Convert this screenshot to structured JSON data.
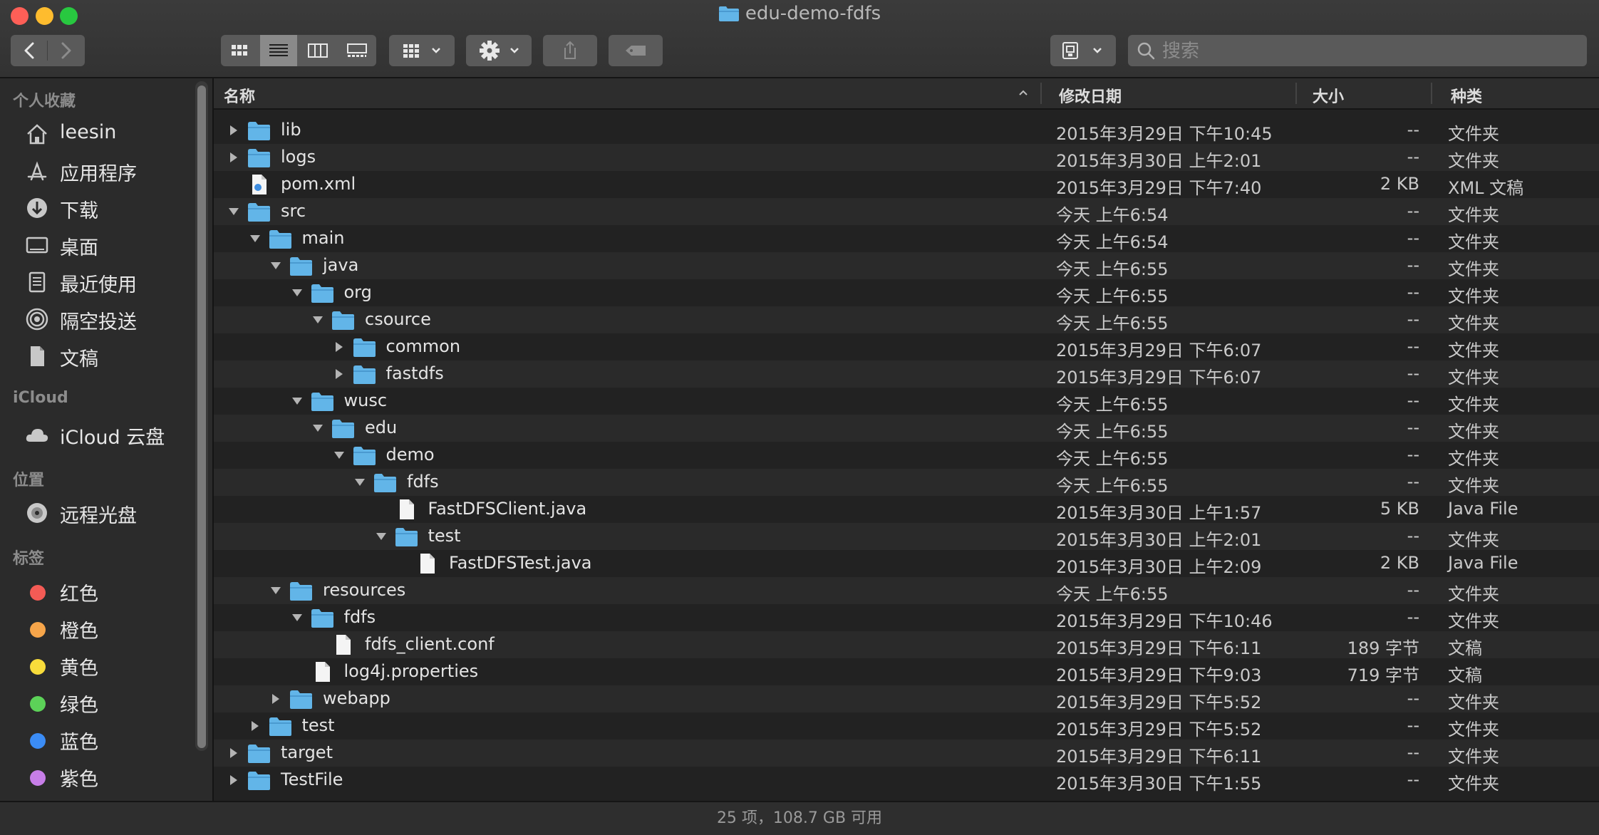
{
  "window": {
    "title": "edu-demo-fdfs",
    "traffic_lights": {
      "close": "#fe5f57",
      "minimize": "#febc2e",
      "zoom": "#28c840"
    }
  },
  "toolbar": {
    "back_icon": "chevron-left-icon",
    "forward_icon": "chevron-right-icon",
    "view_modes": [
      "icon-view",
      "list-view",
      "column-view",
      "gallery-view"
    ],
    "active_view": "list-view",
    "group_icon": "group-grid-icon",
    "action_icon": "gear-icon",
    "share_icon": "share-icon",
    "tag_icon": "tag-icon",
    "dropbox_icon": "folder-sync-icon",
    "search_placeholder": "搜索"
  },
  "sidebar": {
    "sections": [
      {
        "title": "个人收藏",
        "items": [
          {
            "label": "leesin",
            "icon": "home-icon"
          },
          {
            "label": "应用程序",
            "icon": "applications-icon"
          },
          {
            "label": "下载",
            "icon": "download-icon"
          },
          {
            "label": "桌面",
            "icon": "desktop-icon"
          },
          {
            "label": "最近使用",
            "icon": "recents-icon"
          },
          {
            "label": "隔空投送",
            "icon": "airdrop-icon"
          },
          {
            "label": "文稿",
            "icon": "documents-icon"
          }
        ]
      },
      {
        "title": "iCloud",
        "items": [
          {
            "label": "iCloud 云盘",
            "icon": "cloud-icon"
          }
        ]
      },
      {
        "title": "位置",
        "items": [
          {
            "label": "远程光盘",
            "icon": "disc-icon"
          }
        ]
      },
      {
        "title": "标签",
        "items": [
          {
            "label": "红色",
            "color": "#f45b55"
          },
          {
            "label": "橙色",
            "color": "#f6a54a"
          },
          {
            "label": "黄色",
            "color": "#f8dc3b"
          },
          {
            "label": "绿色",
            "color": "#5cd258"
          },
          {
            "label": "蓝色",
            "color": "#3b8cf5"
          },
          {
            "label": "紫色",
            "color": "#c77ee8"
          }
        ]
      }
    ]
  },
  "columns": {
    "name": "名称",
    "date": "修改日期",
    "size": "大小",
    "kind": "种类"
  },
  "files": [
    {
      "name": "lib",
      "depth": 0,
      "type": "folder",
      "state": "collapsed",
      "date": "2015年3月29日 下午10:45",
      "size": "--",
      "kind": "文件夹"
    },
    {
      "name": "logs",
      "depth": 0,
      "type": "folder",
      "state": "collapsed",
      "date": "2015年3月30日 上午2:01",
      "size": "--",
      "kind": "文件夹"
    },
    {
      "name": "pom.xml",
      "depth": 0,
      "type": "xml",
      "state": "none",
      "date": "2015年3月29日 下午7:40",
      "size": "2 KB",
      "kind": "XML 文稿"
    },
    {
      "name": "src",
      "depth": 0,
      "type": "folder",
      "state": "expanded",
      "date": "今天 上午6:54",
      "size": "--",
      "kind": "文件夹"
    },
    {
      "name": "main",
      "depth": 1,
      "type": "folder",
      "state": "expanded",
      "date": "今天 上午6:54",
      "size": "--",
      "kind": "文件夹"
    },
    {
      "name": "java",
      "depth": 2,
      "type": "folder",
      "state": "expanded",
      "date": "今天 上午6:55",
      "size": "--",
      "kind": "文件夹"
    },
    {
      "name": "org",
      "depth": 3,
      "type": "folder",
      "state": "expanded",
      "date": "今天 上午6:55",
      "size": "--",
      "kind": "文件夹"
    },
    {
      "name": "csource",
      "depth": 4,
      "type": "folder",
      "state": "expanded",
      "date": "今天 上午6:55",
      "size": "--",
      "kind": "文件夹"
    },
    {
      "name": "common",
      "depth": 5,
      "type": "folder",
      "state": "collapsed",
      "date": "2015年3月29日 下午6:07",
      "size": "--",
      "kind": "文件夹"
    },
    {
      "name": "fastdfs",
      "depth": 5,
      "type": "folder",
      "state": "collapsed",
      "date": "2015年3月29日 下午6:07",
      "size": "--",
      "kind": "文件夹"
    },
    {
      "name": "wusc",
      "depth": 3,
      "type": "folder",
      "state": "expanded",
      "date": "今天 上午6:55",
      "size": "--",
      "kind": "文件夹"
    },
    {
      "name": "edu",
      "depth": 4,
      "type": "folder",
      "state": "expanded",
      "date": "今天 上午6:55",
      "size": "--",
      "kind": "文件夹"
    },
    {
      "name": "demo",
      "depth": 5,
      "type": "folder",
      "state": "expanded",
      "date": "今天 上午6:55",
      "size": "--",
      "kind": "文件夹"
    },
    {
      "name": "fdfs",
      "depth": 6,
      "type": "folder",
      "state": "expanded",
      "date": "今天 上午6:55",
      "size": "--",
      "kind": "文件夹"
    },
    {
      "name": "FastDFSClient.java",
      "depth": 7,
      "type": "file",
      "state": "none",
      "date": "2015年3月30日 上午1:57",
      "size": "5 KB",
      "kind": "Java File"
    },
    {
      "name": "test",
      "depth": 7,
      "type": "folder",
      "state": "expanded",
      "date": "2015年3月30日 上午2:01",
      "size": "--",
      "kind": "文件夹"
    },
    {
      "name": "FastDFSTest.java",
      "depth": 8,
      "type": "file",
      "state": "none",
      "date": "2015年3月30日 上午2:09",
      "size": "2 KB",
      "kind": "Java File"
    },
    {
      "name": "resources",
      "depth": 2,
      "type": "folder",
      "state": "expanded",
      "date": "今天 上午6:55",
      "size": "--",
      "kind": "文件夹"
    },
    {
      "name": "fdfs",
      "depth": 3,
      "type": "folder",
      "state": "expanded",
      "date": "2015年3月29日 下午10:46",
      "size": "--",
      "kind": "文件夹"
    },
    {
      "name": "fdfs_client.conf",
      "depth": 4,
      "type": "file",
      "state": "none",
      "date": "2015年3月29日 下午6:11",
      "size": "189 字节",
      "kind": "文稿"
    },
    {
      "name": "log4j.properties",
      "depth": 3,
      "type": "file",
      "state": "none",
      "date": "2015年3月29日 下午9:03",
      "size": "719 字节",
      "kind": "文稿"
    },
    {
      "name": "webapp",
      "depth": 2,
      "type": "folder",
      "state": "collapsed",
      "date": "2015年3月29日 下午5:52",
      "size": "--",
      "kind": "文件夹"
    },
    {
      "name": "test",
      "depth": 1,
      "type": "folder",
      "state": "collapsed",
      "date": "2015年3月29日 下午5:52",
      "size": "--",
      "kind": "文件夹"
    },
    {
      "name": "target",
      "depth": 0,
      "type": "folder",
      "state": "collapsed",
      "date": "2015年3月29日 下午6:11",
      "size": "--",
      "kind": "文件夹"
    },
    {
      "name": "TestFile",
      "depth": 0,
      "type": "folder",
      "state": "collapsed",
      "date": "2015年3月30日 下午1:55",
      "size": "--",
      "kind": "文件夹"
    }
  ],
  "status": {
    "text": "25 项，108.7 GB 可用"
  }
}
